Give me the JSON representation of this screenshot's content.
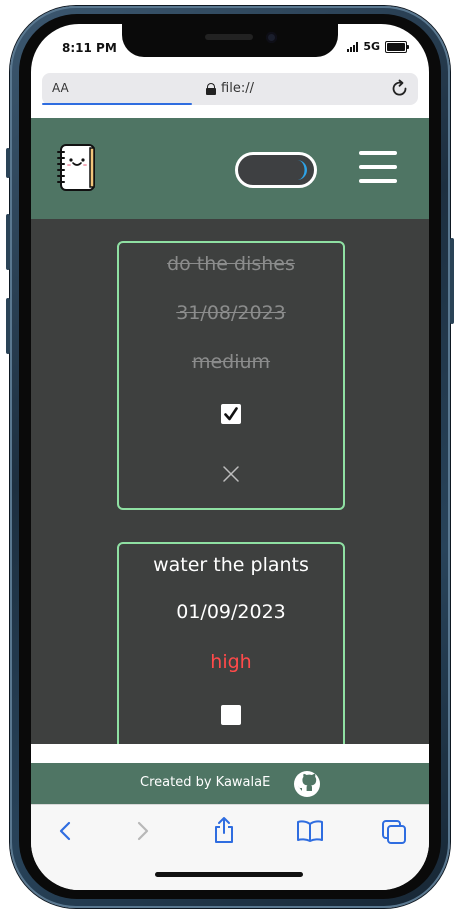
{
  "status_bar": {
    "time": "8:11 PM",
    "network": "5G"
  },
  "browser": {
    "aa_label": "AA",
    "url": "file://"
  },
  "app": {
    "tasks": [
      {
        "name": "do the dishes",
        "date": "31/08/2023",
        "priority": "medium",
        "completed": true
      },
      {
        "name": "water the plants",
        "date": "01/09/2023",
        "priority": "high",
        "completed": false
      }
    ],
    "footer_text": "Created by KawalaE"
  },
  "colors": {
    "header_green": "#4f7564",
    "content_bg": "#3e403f",
    "card_border": "#8fe0a3",
    "priority_high": "#ff4a4a",
    "completed_text": "#8b8c8c",
    "ios_blue": "#2f6de0"
  },
  "icons": {
    "logo": "notebook-face-icon",
    "theme_toggle": "moon-icon",
    "menu": "hamburger-menu-icon",
    "check": "check-icon",
    "delete": "close-icon",
    "github": "github-icon",
    "browser_back": "chevron-left-icon",
    "browser_forward": "chevron-right-icon",
    "share": "share-icon",
    "bookmarks": "book-icon",
    "tabs": "tabs-icon",
    "reload": "reload-icon",
    "lock": "lock-icon"
  },
  "page_load_progress": 0.4
}
